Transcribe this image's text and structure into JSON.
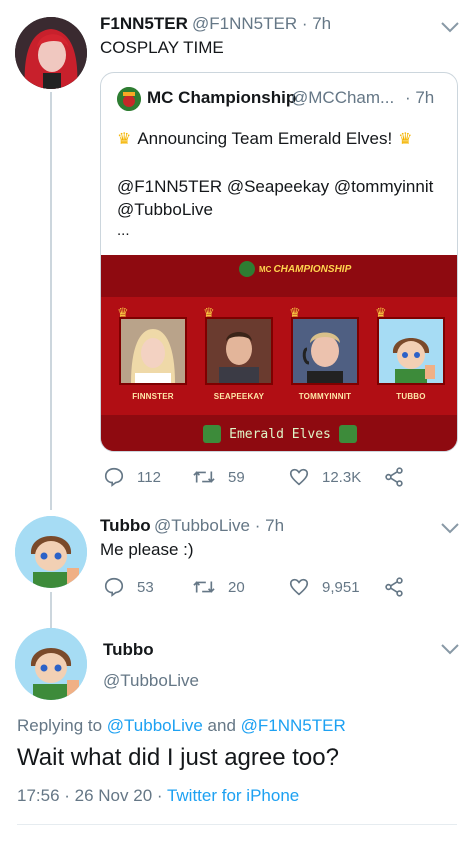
{
  "tweet1": {
    "name": "F1NN5TER",
    "handle": "@F1NN5TER",
    "time": "· 7h",
    "text": "COSPLAY TIME",
    "quote": {
      "name": "MC Championship",
      "handle": "@MCCham...",
      "time": "· 7h",
      "line1": "Announcing Team Emerald Elves!",
      "line2": "@F1NN5TER @Seapeekay @tommyinnit",
      "line3": "@TubboLive",
      "ellipsis": "...",
      "banner": {
        "logo_small": "MC",
        "logo_text": "CHAMPIONSHIP",
        "players": [
          "FINNSTER",
          "SEAPEEKAY",
          "TOMMYINNIT",
          "TUBBO"
        ],
        "team_name": "Emerald Elves"
      }
    },
    "replies": "112",
    "retweets": "59",
    "likes": "12.3K"
  },
  "tweet2": {
    "name": "Tubbo",
    "handle": "@TubboLive",
    "time": "· 7h",
    "text": "Me please :)",
    "replies": "53",
    "retweets": "20",
    "likes": "9,951"
  },
  "tweet3": {
    "name": "Tubbo",
    "handle": "@TubboLive",
    "replying_prefix": "Replying to",
    "replying_user1": "@TubboLive",
    "replying_and": "and",
    "replying_user2": "@F1NN5TER",
    "text": "Wait what did I just agree too?",
    "timestamp": "17:56 · 26 Nov 20 ·",
    "source": "Twitter for iPhone"
  },
  "colors": {
    "link": "#1da1f2",
    "muted": "#657786",
    "banner_red": "#b10e14",
    "team_green": "#3d8b3a"
  }
}
